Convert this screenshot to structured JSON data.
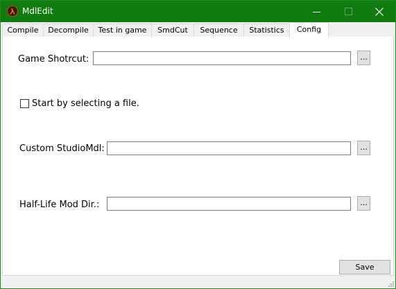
{
  "window": {
    "title": "MdlEdit",
    "title_bar_color": "#107c10",
    "icon": "half-life-lambda-icon",
    "controls": [
      "minimize-icon",
      "maximize-icon",
      "close-icon"
    ]
  },
  "tabs": [
    {
      "label": "Compile",
      "active": false
    },
    {
      "label": "Decompile",
      "active": false
    },
    {
      "label": "Test in game",
      "active": false
    },
    {
      "label": "SmdCut",
      "active": false
    },
    {
      "label": "Sequence",
      "active": false
    },
    {
      "label": "Statistics",
      "active": false
    },
    {
      "label": "Config",
      "active": true
    }
  ],
  "config": {
    "game_shortcut": {
      "label": "Game Shotrcut:",
      "value": "",
      "browse_label": "..."
    },
    "start_by_selecting": {
      "label": "Start by selecting a file.",
      "checked": false
    },
    "custom_studiomdl": {
      "label": "Custom StudioMdl:",
      "value": "",
      "browse_label": "..."
    },
    "halflife_mod_dir": {
      "label": "Half-Life Mod Dir.:",
      "value": "",
      "browse_label": "..."
    }
  },
  "footer": {
    "save_label": "Save"
  }
}
